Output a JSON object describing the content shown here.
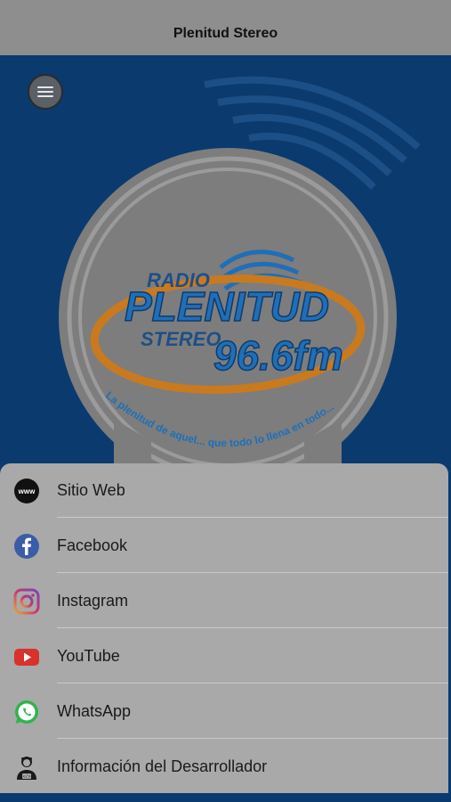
{
  "header": {
    "title": "Plenitud Stereo"
  },
  "logo": {
    "radio": "RADIO",
    "name": "PLENITUD",
    "stereo": "STEREO",
    "frequency": "96.6fm",
    "slogan": "La plenitud de aquel... que todo lo llena en todo..."
  },
  "menu": {
    "icon": "hamburger-menu-icon",
    "items": [
      {
        "label": "Sitio Web",
        "icon": "www-globe-icon"
      },
      {
        "label": "Facebook",
        "icon": "facebook-icon"
      },
      {
        "label": "Instagram",
        "icon": "instagram-icon"
      },
      {
        "label": "YouTube",
        "icon": "youtube-icon"
      },
      {
        "label": "WhatsApp",
        "icon": "whatsapp-icon"
      },
      {
        "label": "Información del Desarrollador",
        "icon": "developer-icon"
      }
    ]
  },
  "colors": {
    "background_blue": "#0b3a6e",
    "logo_orange": "#c97a1e",
    "logo_blue": "#1f6fb8",
    "sheet_gray": "#a9a9a9"
  }
}
